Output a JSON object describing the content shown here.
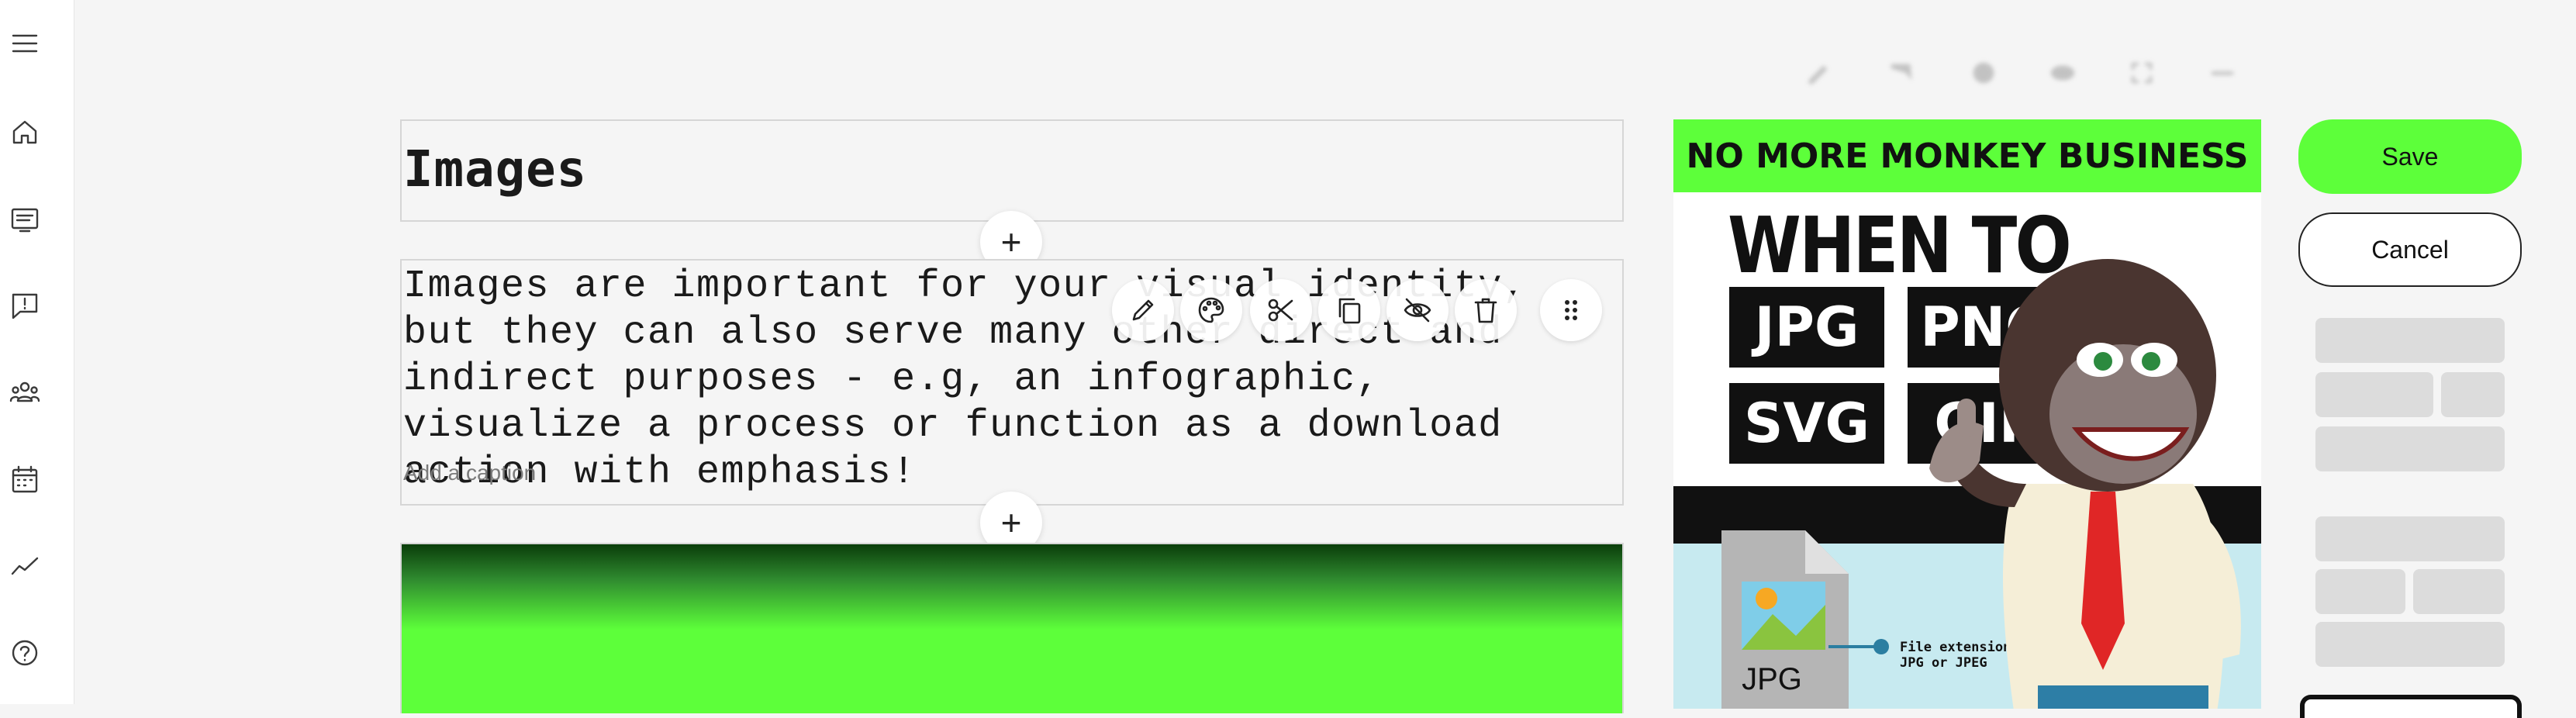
{
  "sidebar": {
    "items": [
      {
        "icon": "menu-icon",
        "label": "menu"
      },
      {
        "icon": "home-icon",
        "label": "home"
      },
      {
        "icon": "content-icon",
        "label": "content"
      },
      {
        "icon": "feedback-icon",
        "label": "feedback"
      },
      {
        "icon": "users-icon",
        "label": "users"
      },
      {
        "icon": "calendar-icon",
        "label": "calendar"
      },
      {
        "icon": "analytics-icon",
        "label": "analytics"
      },
      {
        "icon": "help-icon",
        "label": "help"
      }
    ]
  },
  "topbar": {
    "icons": [
      "edit-icon",
      "flag-icon",
      "circle-icon",
      "visibility-icon",
      "fullscreen-icon",
      "more-icon"
    ]
  },
  "editor": {
    "title": "Images",
    "paragraph": "Images are important for your visual identity, but they can also serve many other direct and indirect purposes - e.g, an infographic, visualize a process or function as a download action with emphasis!",
    "caption_placeholder": "Add a caption",
    "add_label": "+",
    "toolbar": [
      "edit-icon",
      "palette-icon",
      "cut-icon",
      "copy-icon",
      "hide-icon",
      "delete-icon",
      "drag-handle-icon"
    ]
  },
  "poster": {
    "banner": "NO MORE MONKEY BUSINESS",
    "heading": "WHEN TO USE",
    "formats": [
      "JPG",
      "PNG",
      "SVG",
      "GIF"
    ],
    "file_extension_label": "File extension:",
    "file_extension_value": "JPG or JPEG",
    "file_label": "JPG"
  },
  "actions": {
    "save": "Save",
    "cancel": "Cancel"
  },
  "colors": {
    "accent": "#5dff3a",
    "background": "#f5f5f5",
    "text": "#1a1a1a"
  }
}
